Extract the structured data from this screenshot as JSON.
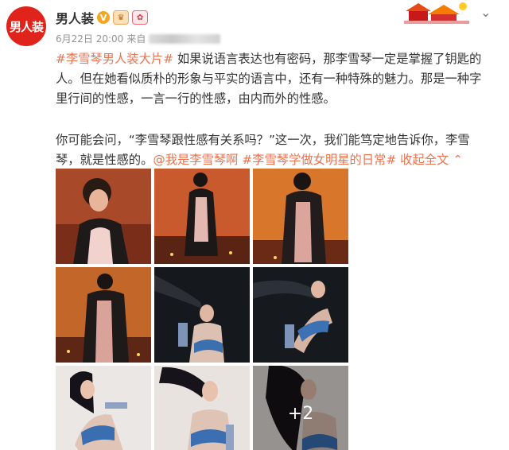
{
  "author": {
    "name": "男人装",
    "avatar_text": "男人装",
    "verified_mark": "V"
  },
  "meta": {
    "date": "6月22日 20:00",
    "source_prefix": "来自"
  },
  "content": {
    "topic1": "#李雪琴男人装大片#",
    "para1_rest": " 如果说语言表达也有密码，那李雪琴一定是掌握了钥匙的人。但在她看似质朴的形象与平实的语言中，还有一种特殊的魅力。那是一种字里行间的性感，一言一行的性感，由内而外的性感。",
    "para2": "你可能会问，“李雪琴跟性感有关系吗？”这一次，我们能笃定地告诉你，李雪琴，就是性感的。",
    "mention": "@我是李雪琴啊",
    "topic2": "#李雪琴学做女明星的日常#",
    "collapse": "收起全文",
    "collapse_icon": "chevron-up-icon"
  },
  "images": {
    "count": 9,
    "more_label": "+2"
  },
  "colors": {
    "link": "#eb7350",
    "brand_red": "#e0241b",
    "meta_gray": "#939393"
  }
}
